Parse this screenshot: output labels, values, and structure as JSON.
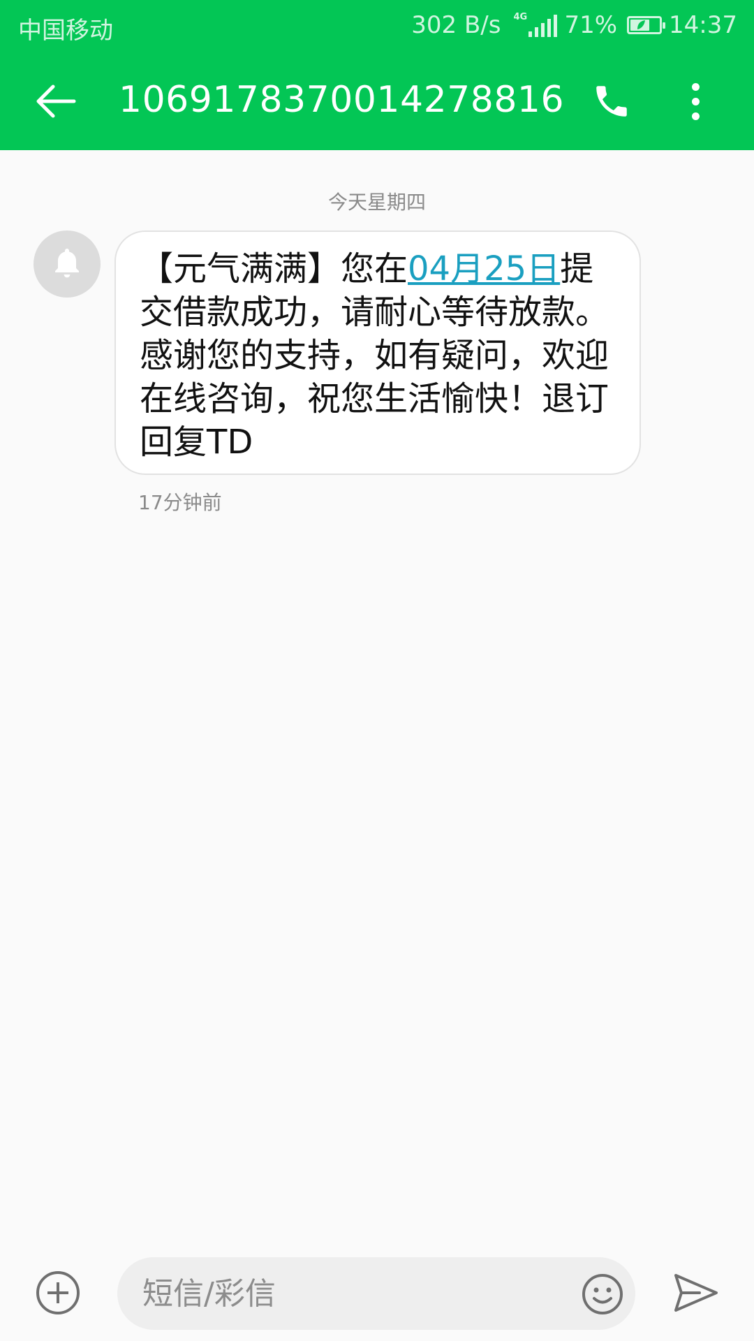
{
  "status_bar": {
    "carrier": "中国移动",
    "net_speed": "302 B/s",
    "network_type": "4G",
    "battery": "71%",
    "battery_level": 0.71,
    "time": "14:37"
  },
  "app_bar": {
    "contact": "1069178370014278816",
    "back_icon": "arrow-left-icon",
    "call_icon": "phone-icon",
    "more_icon": "more-vert-icon"
  },
  "conversation": {
    "date_divider": "今天星期四",
    "messages": [
      {
        "avatar_icon": "bell-icon",
        "text_before_link": "【元气满满】您在",
        "link": "04月25日",
        "text_after_link": "提交借款成功，请耐心等待放款。感谢您的支持，如有疑问，欢迎在线咨询，祝您生活愉快！退订回复TD",
        "time": "17分钟前"
      }
    ]
  },
  "composer": {
    "placeholder": "短信/彩信",
    "add_icon": "plus-circle-icon",
    "emoji_icon": "smiley-icon",
    "send_icon": "send-icon"
  },
  "colors": {
    "header": "#03c655",
    "link": "#1a9fc0",
    "background": "#fafafa"
  }
}
